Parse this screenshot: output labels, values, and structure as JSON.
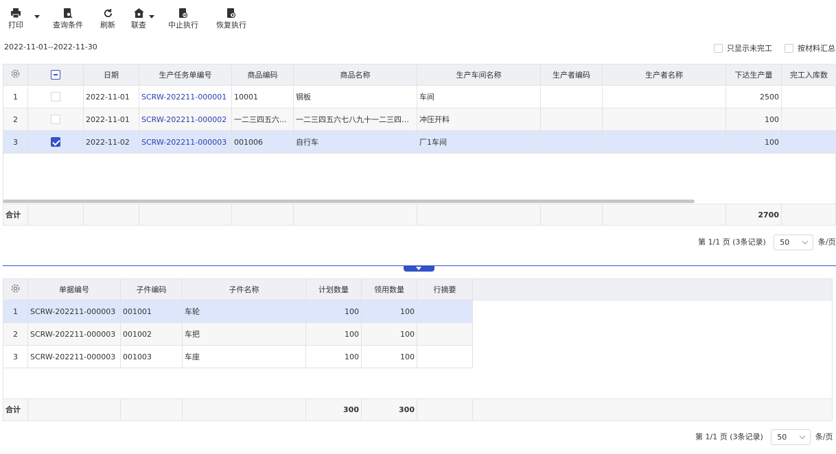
{
  "toolbar": {
    "print": "打印",
    "query": "查询条件",
    "refresh": "刷新",
    "linked": "联查",
    "stop": "中止执行",
    "resume": "恢复执行"
  },
  "filter": {
    "date_range": "2022-11-01--2022-11-30",
    "only_unfinished": "只显示未完工",
    "by_material": "按材料汇总"
  },
  "main_table": {
    "headers": [
      "日期",
      "生产任务单编号",
      "商品编码",
      "商品名称",
      "生产车间名称",
      "生产者编码",
      "生产者名称",
      "下达生产量",
      "完工入库数"
    ],
    "rows": [
      {
        "idx": "1",
        "date": "2022-11-01",
        "order": "SCRW-202211-000001",
        "code": "10001",
        "name": "钢板",
        "workshop": "车间",
        "maker_code": "",
        "maker_name": "",
        "qty": "2500",
        "done": ""
      },
      {
        "idx": "2",
        "date": "2022-11-01",
        "order": "SCRW-202211-000002",
        "code": "一二三四五六...",
        "name": "一二三四五六七八九十一二三四五...",
        "workshop": "冲压开料",
        "maker_code": "",
        "maker_name": "",
        "qty": "100",
        "done": ""
      },
      {
        "idx": "3",
        "date": "2022-11-02",
        "order": "SCRW-202211-000003",
        "code": "001006",
        "name": "自行车",
        "workshop": "厂1车间",
        "maker_code": "",
        "maker_name": "",
        "qty": "100",
        "done": ""
      }
    ],
    "total_label": "合计",
    "total_qty": "2700",
    "pager_text": "第 1/1 页 (3条记录)",
    "page_size": "50",
    "per_page": "条/页"
  },
  "detail_table": {
    "headers": [
      "单据编号",
      "子件编码",
      "子件名称",
      "计划数量",
      "领用数量",
      "行摘要"
    ],
    "rows": [
      {
        "idx": "1",
        "doc": "SCRW-202211-000003",
        "code": "001001",
        "name": "车轮",
        "plan": "100",
        "used": "100",
        "memo": ""
      },
      {
        "idx": "2",
        "doc": "SCRW-202211-000003",
        "code": "001002",
        "name": "车把",
        "plan": "100",
        "used": "100",
        "memo": ""
      },
      {
        "idx": "3",
        "doc": "SCRW-202211-000003",
        "code": "001003",
        "name": "车座",
        "plan": "100",
        "used": "100",
        "memo": ""
      }
    ],
    "total_label": "合计",
    "total_plan": "300",
    "total_used": "300",
    "pager_text": "第 1/1 页 (3条记录)",
    "page_size": "50",
    "per_page": "条/页"
  },
  "colors": {
    "accent": "#3451c7",
    "selected_row": "#dde6fb",
    "header_bg": "#eef0f4",
    "link": "#2a3fae"
  }
}
